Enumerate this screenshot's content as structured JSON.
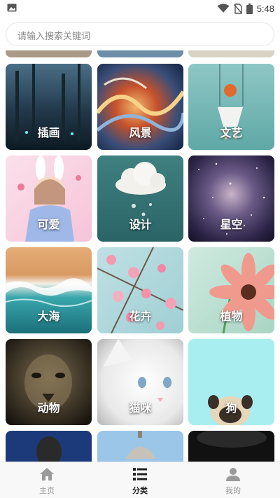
{
  "status_bar": {
    "time": "5:48",
    "left_icon": "image-icon",
    "right_icons": [
      "wifi-icon",
      "no-sim-icon",
      "battery-icon"
    ]
  },
  "search": {
    "placeholder": "请输入搜索关键词",
    "value": ""
  },
  "categories": [
    {
      "label": "插画",
      "image": "forest-night-illustration"
    },
    {
      "label": "风景",
      "image": "colorful-abstract-waves"
    },
    {
      "label": "文艺",
      "image": "girl-on-swing"
    },
    {
      "label": "可爱",
      "image": "pastel-bunny-girl"
    },
    {
      "label": "设计",
      "image": "cloud-raindrops"
    },
    {
      "label": "星空",
      "image": "starry-nebula"
    },
    {
      "label": "大海",
      "image": "ocean-shore-aerial"
    },
    {
      "label": "花卉",
      "image": "pink-blossoms"
    },
    {
      "label": "植物",
      "image": "pink-gerbera-flower"
    },
    {
      "label": "动物",
      "image": "lion-face"
    },
    {
      "label": "猫咪",
      "image": "white-cat"
    },
    {
      "label": "狗",
      "image": "pug-dog"
    }
  ],
  "tabs": [
    {
      "label": "主页",
      "icon": "home-icon",
      "active": false
    },
    {
      "label": "分类",
      "icon": "list-icon",
      "active": true
    },
    {
      "label": "我的",
      "icon": "person-icon",
      "active": false
    }
  ],
  "colors": {
    "tab_active": "#222222",
    "tab_inactive": "#999999",
    "background": "#ffffff"
  }
}
